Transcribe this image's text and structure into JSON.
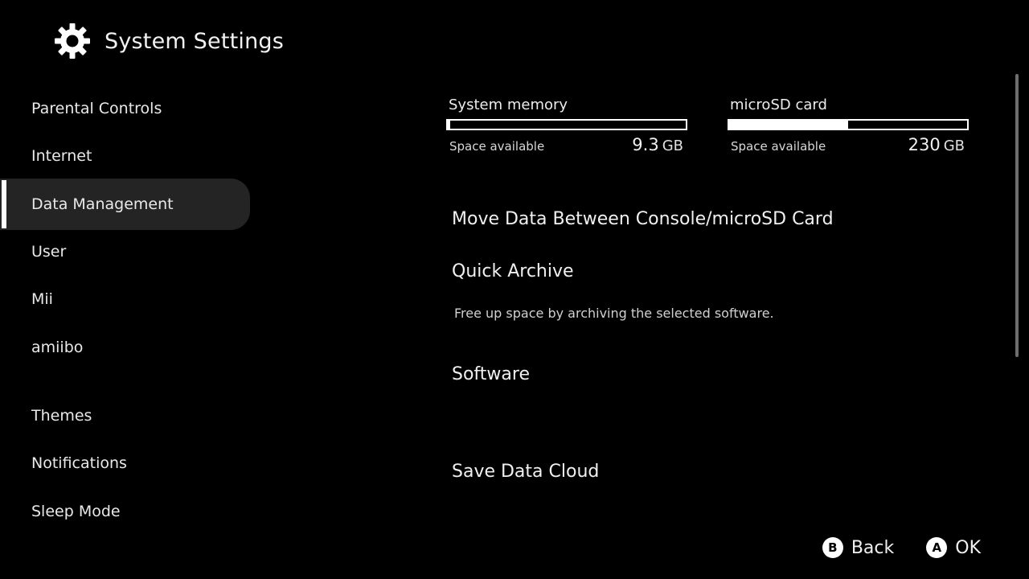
{
  "header": {
    "title": "System Settings",
    "icon": "gear-icon"
  },
  "sidebar": {
    "items": [
      {
        "label": "Parental Controls"
      },
      {
        "label": "Internet"
      },
      {
        "label": "Data Management",
        "selected": true
      },
      {
        "label": "User"
      },
      {
        "label": "Mii"
      },
      {
        "label": "amiibo"
      },
      {
        "label": "Themes"
      },
      {
        "label": "Notifications"
      },
      {
        "label": "Sleep Mode"
      }
    ]
  },
  "storage": {
    "system": {
      "title": "System memory",
      "available_label": "Space available",
      "value": "9.3",
      "unit": "GB",
      "used_fraction": 0.01
    },
    "sd": {
      "title": "microSD card",
      "available_label": "Space available",
      "value": "230",
      "unit": "GB",
      "used_fraction": 0.5
    }
  },
  "content": {
    "move_data": "Move Data Between Console/microSD Card",
    "quick_archive": "Quick Archive",
    "quick_archive_desc": "Free up space by archiving the selected software.",
    "software": "Software",
    "save_data_cloud": "Save Data Cloud"
  },
  "footer": {
    "back": {
      "button": "B",
      "label": "Back"
    },
    "ok": {
      "button": "A",
      "label": "OK"
    }
  },
  "colors": {
    "background": "#000000",
    "selected_bg": "#242424",
    "text": "#f0f0f0",
    "accent": "#ffffff"
  }
}
